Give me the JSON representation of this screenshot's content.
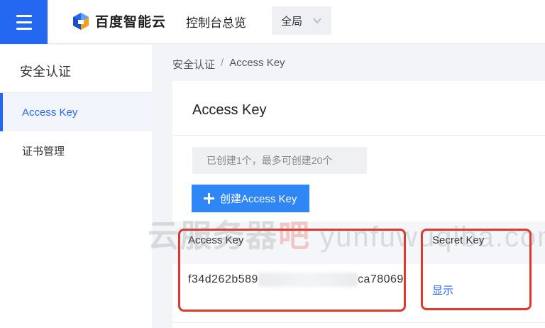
{
  "header": {
    "brand": "百度智能云",
    "console_title": "控制台总览",
    "region": "全局"
  },
  "sidebar": {
    "title": "安全认证",
    "items": [
      {
        "label": "Access Key",
        "active": true
      },
      {
        "label": "证书管理",
        "active": false
      }
    ]
  },
  "breadcrumb": {
    "parent": "安全认证",
    "separator": "/",
    "current": "Access Key"
  },
  "main": {
    "title": "Access Key",
    "quota_note": "已创建1个，最多可创建20个",
    "create_button": "创建Access Key",
    "table": {
      "columns": [
        "Access Key",
        "Secret Key"
      ],
      "rows": [
        {
          "access_key_prefix": "f34d262b589",
          "access_key_suffix": "ca78069",
          "secret_action": "显示"
        }
      ]
    }
  },
  "watermark": {
    "cn": "云服务器",
    "cn_red": "吧",
    "latin": " yunfuwuqiba.com"
  },
  "colors": {
    "primary": "#2468f2",
    "button": "#2f87f6",
    "highlight": "#e0382a"
  },
  "icons": [
    "menu-icon",
    "baidu-cloud-logo",
    "chevron-down-icon",
    "plus-icon"
  ]
}
